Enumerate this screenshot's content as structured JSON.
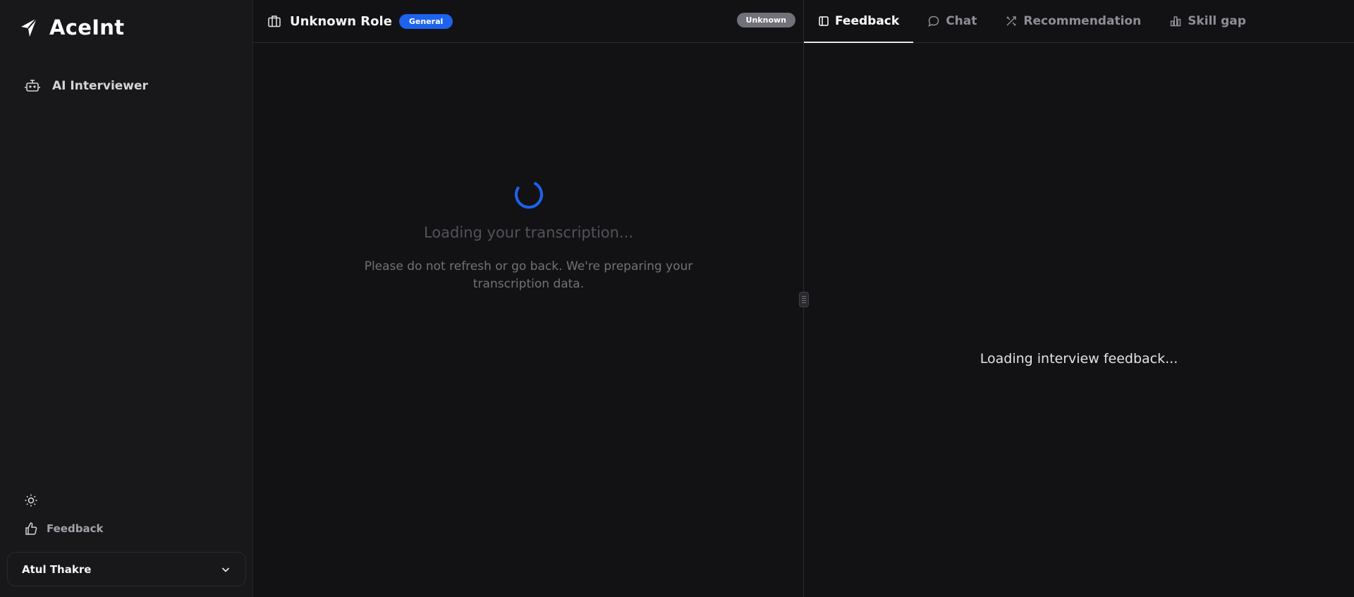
{
  "sidebar": {
    "logo_text": "AceInt",
    "nav_items": [
      {
        "label": "AI Interviewer",
        "icon": "bot-icon"
      }
    ],
    "theme_icon": "sun-icon",
    "feedback_label": "Feedback",
    "user_name": "Atul Thakre"
  },
  "center": {
    "role_title": "Unknown Role",
    "role_badge": "General",
    "status_badge": "Unknown",
    "loading_title": "Loading your transcription...",
    "loading_subtitle": "Please do not refresh or go back. We're preparing your transcription data."
  },
  "right": {
    "tabs": [
      {
        "label": "Feedback",
        "icon": "panel-icon",
        "active": true
      },
      {
        "label": "Chat",
        "icon": "chat-bubble-icon",
        "active": false
      },
      {
        "label": "Recommendation",
        "icon": "tools-icon",
        "active": false
      },
      {
        "label": "Skill gap",
        "icon": "bar-chart-icon",
        "active": false
      }
    ],
    "loading_text": "Loading interview feedback..."
  },
  "colors": {
    "accent": "#1d63ed",
    "background": "#121214",
    "sidebar": "#18181b"
  }
}
